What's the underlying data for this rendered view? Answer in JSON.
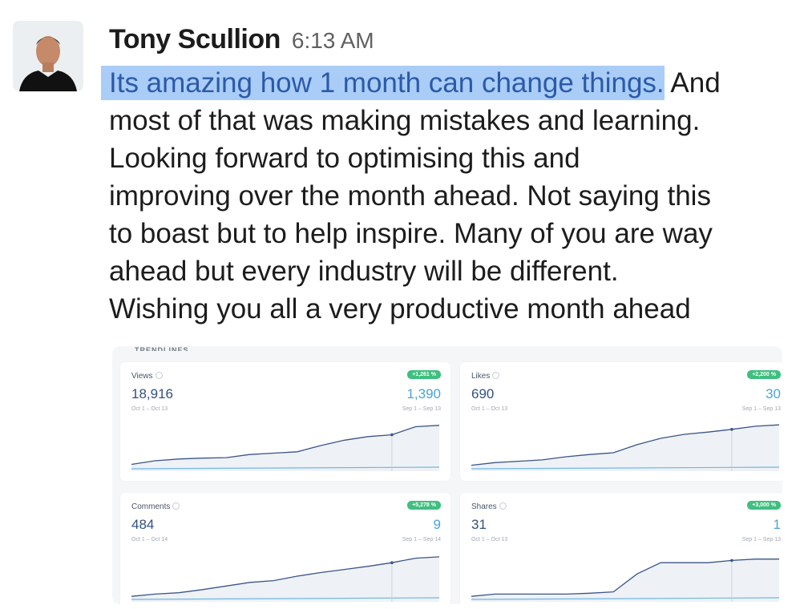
{
  "message": {
    "sender": "Tony Scullion",
    "timestamp": "6:13 AM",
    "highlighted_text": "Its amazing how 1 month can change things.",
    "lines": [
      " And",
      "most of that was making mistakes and learning.",
      "Looking forward to optimising this and",
      "improving over the month ahead. Not saying this",
      "to boast but to help inspire. Many of you are way",
      "ahead but every industry will be different.",
      "Wishing you all a very productive month ahead"
    ]
  },
  "attachment": {
    "section_title": "TRENDLINES",
    "cards": [
      {
        "label": "Views",
        "value": "18,916",
        "date_range": "Oct 1 – Oct 13",
        "badge": "+1,261 %",
        "prev_value": "1,390",
        "prev_date_range": "Sep 1 – Sep 13",
        "trend": [
          0.08,
          0.16,
          0.2,
          0.22,
          0.23,
          0.3,
          0.33,
          0.36,
          0.5,
          0.62,
          0.7,
          0.74,
          0.92,
          0.95
        ]
      },
      {
        "label": "Likes",
        "value": "690",
        "date_range": "Oct 1 – Oct 13",
        "badge": "+2,200 %",
        "prev_value": "30",
        "prev_date_range": "Sep 1 – Sep 13",
        "trend": [
          0.06,
          0.12,
          0.15,
          0.18,
          0.25,
          0.3,
          0.34,
          0.52,
          0.66,
          0.75,
          0.8,
          0.86,
          0.93,
          0.96
        ]
      },
      {
        "label": "Comments",
        "value": "484",
        "date_range": "Oct 1 – Oct 14",
        "badge": "+5,278 %",
        "prev_value": "9",
        "prev_date_range": "Sep 1 – Sep 14",
        "trend": [
          0.05,
          0.1,
          0.13,
          0.2,
          0.28,
          0.36,
          0.4,
          0.5,
          0.58,
          0.65,
          0.72,
          0.8,
          0.9,
          0.93
        ]
      },
      {
        "label": "Shares",
        "value": "31",
        "date_range": "Oct 1 – Oct 13",
        "badge": "+3,000 %",
        "prev_value": "1",
        "prev_date_range": "Sep 1 – Sep 13",
        "trend": [
          0.05,
          0.1,
          0.1,
          0.1,
          0.1,
          0.12,
          0.15,
          0.55,
          0.8,
          0.8,
          0.8,
          0.85,
          0.88,
          0.88
        ]
      }
    ]
  },
  "colors": {
    "highlight": "#a9cdf6",
    "link_text": "#2c5aa9",
    "badge": "#3fbf7f",
    "value": "#33507f",
    "prev_value": "#4aa3d8"
  }
}
